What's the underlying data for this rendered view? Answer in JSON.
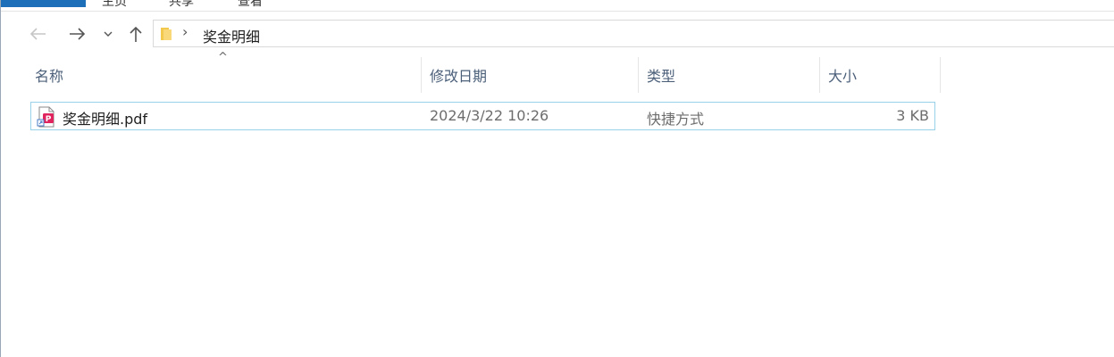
{
  "ribbon": {
    "tabs": [
      "主页",
      "共享",
      "查看"
    ]
  },
  "nav": {
    "back_icon": "arrow-left",
    "forward_icon": "arrow-right",
    "recent_icon": "chevron-down",
    "up_icon": "arrow-up"
  },
  "address": {
    "folder_icon": "folder",
    "separator": "›",
    "crumb": "奖金明细"
  },
  "columns": {
    "name": "名称",
    "date": "修改日期",
    "type": "类型",
    "size": "大小",
    "sort_indicator": "^"
  },
  "files": [
    {
      "name": "奖金明细.pdf",
      "modified": "2024/3/22 10:26",
      "type": "快捷方式",
      "size": "3 KB",
      "icon": "pdf-shortcut"
    }
  ],
  "colors": {
    "accent": "#1c6fb8",
    "selection_border": "#99d1e8",
    "header_text": "#4c607a"
  }
}
